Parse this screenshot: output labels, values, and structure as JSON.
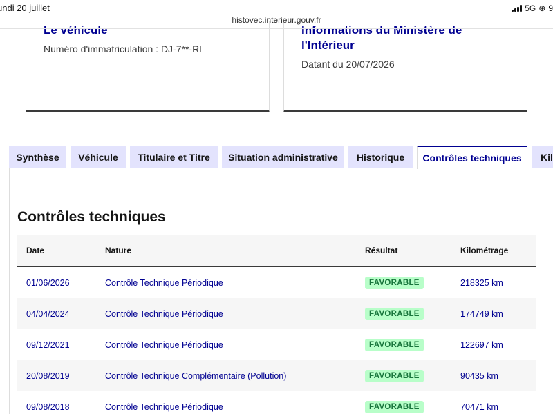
{
  "status_bar": {
    "time": "undi 20 juillet",
    "network": "5G",
    "battery": "9"
  },
  "browser": {
    "url": "histovec.interieur.gouv.fr"
  },
  "cards": {
    "vehicle": {
      "title": "Le véhicule",
      "registration": "Numéro d'immatriculation : DJ-7**-RL"
    },
    "ministry": {
      "title_line1": "Informations du Ministère de",
      "title_line2": "l'Intérieur",
      "date": "Datant du 20/07/2026"
    }
  },
  "tabs": [
    {
      "label": "Synthèse"
    },
    {
      "label": "Véhicule"
    },
    {
      "label": "Titulaire et Titre"
    },
    {
      "label": "Situation administrative"
    },
    {
      "label": "Historique"
    },
    {
      "label": "Contrôles techniques",
      "active": true
    },
    {
      "label": "Kilo"
    }
  ],
  "section": {
    "title": "Contrôles techniques"
  },
  "table": {
    "headers": {
      "date": "Date",
      "nature": "Nature",
      "result": "Résultat",
      "mileage": "Kilométrage"
    },
    "rows": [
      {
        "date": "01/06/2026",
        "nature": "Contrôle Technique Périodique",
        "result": "FAVORABLE",
        "mileage": "218325 km"
      },
      {
        "date": "04/04/2024",
        "nature": "Contrôle Technique Périodique",
        "result": "FAVORABLE",
        "mileage": "174749 km"
      },
      {
        "date": "09/12/2021",
        "nature": "Contrôle Technique Périodique",
        "result": "FAVORABLE",
        "mileage": "122697 km"
      },
      {
        "date": "20/08/2019",
        "nature": "Contrôle Technique Complémentaire (Pollution)",
        "result": "FAVORABLE",
        "mileage": "90435 km"
      },
      {
        "date": "09/08/2018",
        "nature": "Contrôle Technique Périodique",
        "result": "FAVORABLE",
        "mileage": "70471 km"
      }
    ]
  },
  "colors": {
    "accent": "#000091",
    "tab_bg": "#e3e3fd",
    "badge_bg": "#b8fec9",
    "badge_text": "#18753c"
  }
}
